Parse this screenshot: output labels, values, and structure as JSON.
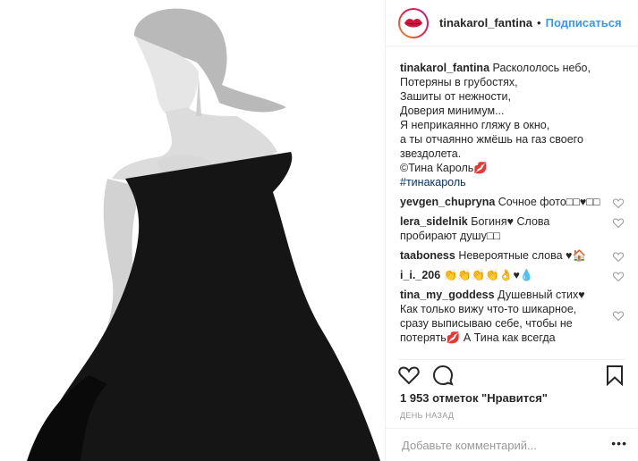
{
  "header": {
    "username": "tinakarol_fantina",
    "separator": "•",
    "follow_label": "Подписаться"
  },
  "caption": {
    "username": "tinakarol_fantina",
    "lines": [
      "Раскололось небо,",
      "Потеряны в грубостях,",
      "Зашиты от нежности,",
      "Доверия минимум...",
      "Я неприкаянно гляжу в окно,",
      "а ты отчаянно жмёшь на газ своего звездолета.",
      "©Тина Кароль💋"
    ],
    "hashtag": "#тинакароль"
  },
  "comments": [
    {
      "username": "yevgen_chupryna",
      "text": "Сочное фото□□♥□□"
    },
    {
      "username": "lera_sidelnik",
      "text": "Богиня♥ Слова пробирают душу□□"
    },
    {
      "username": "taaboness",
      "text": "Невероятные слова ♥🏠"
    },
    {
      "username": "i_i._206",
      "text": "👏👏👏👏👌♥💧"
    },
    {
      "username": "tina_my_goddess",
      "text": "Душевный стих♥ Как только вижу что-то шикарное, сразу выписываю себе, чтобы не потерять💋 А Тина как всегда"
    }
  ],
  "likes": "1 953 отметок \"Нравится\"",
  "time": "ДЕНЬ НАЗАД",
  "add_comment": {
    "placeholder": "Добавьте комментарий..."
  },
  "more_label": "•••",
  "icons": {
    "like": "heart-icon",
    "comment": "comment-icon",
    "share": "share-icon",
    "save": "bookmark-icon"
  }
}
